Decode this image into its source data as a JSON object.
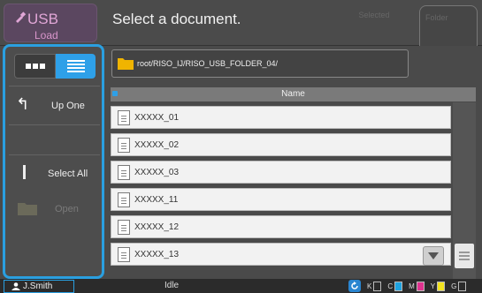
{
  "header": {
    "app_title": "USB",
    "app_subtitle": "Load",
    "page_title": "Select a document.",
    "tab_selected": "Selected",
    "tab_folder": "Folder"
  },
  "left_panel": {
    "view_modes": [
      "grid-view-icon",
      "list-view-icon"
    ],
    "active_view": "list",
    "up_one_label": "Up One",
    "select_all_label": "Select All",
    "open_label": "Open"
  },
  "path": "root/RISO_IJ/RISO_USB_FOLDER_04/",
  "list": {
    "column_header": "Name",
    "rows": [
      "XXXXX_01",
      "XXXXX_02",
      "XXXXX_03",
      "XXXXX_11",
      "XXXXX_12",
      "XXXXX_13"
    ]
  },
  "status_bar": {
    "user": "J.Smith",
    "status": "Idle",
    "inks": [
      {
        "label": "K",
        "color": "#000000",
        "level": 0
      },
      {
        "label": "C",
        "color": "#1fa3e0",
        "level": 1.0
      },
      {
        "label": "M",
        "color": "#e0338f",
        "level": 1.0
      },
      {
        "label": "Y",
        "color": "#f2e21f",
        "level": 1.0
      },
      {
        "label": "G",
        "color": "#cccccc",
        "level": 0
      }
    ]
  },
  "colors": {
    "accent": "#2a9fe0",
    "app_tile": "#5b4760",
    "app_text": "#e0a6d6",
    "folder": "#f0b400"
  }
}
